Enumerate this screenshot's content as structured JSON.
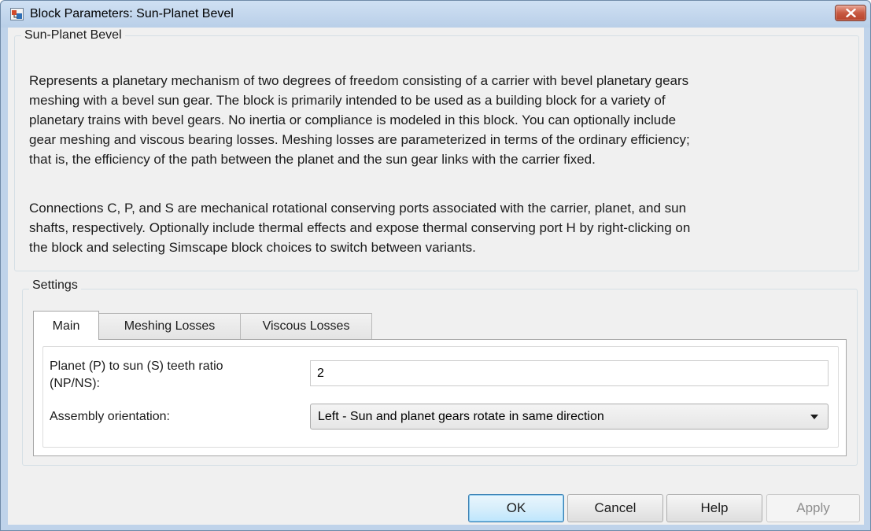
{
  "window": {
    "title": "Block Parameters: Sun-Planet Bevel"
  },
  "description_group": {
    "label": "Sun-Planet Bevel",
    "paragraph1_lines": [
      "Represents a planetary mechanism of two degrees of freedom consisting of a carrier with bevel planetary gears",
      "meshing with a bevel sun gear. The block is primarily intended to be used as a building block for a variety of",
      "planetary trains with bevel gears. No inertia or compliance is modeled in this block. You can optionally include",
      "gear meshing and viscous bearing losses. Meshing losses are parameterized in terms of the ordinary efficiency;",
      "that is, the efficiency of the path between the planet and the sun gear links with the carrier fixed."
    ],
    "paragraph2_lines": [
      "Connections C, P, and S are mechanical rotational conserving ports associated with the carrier, planet, and sun",
      "shafts, respectively. Optionally include thermal effects and expose thermal conserving port H by right-clicking on",
      "the block and selecting Simscape block choices to switch between variants."
    ]
  },
  "settings": {
    "label": "Settings",
    "tabs": [
      {
        "label": "Main",
        "active": true
      },
      {
        "label": "Meshing Losses",
        "active": false
      },
      {
        "label": "Viscous Losses",
        "active": false
      }
    ],
    "main": {
      "ratio_label_line1": "Planet (P) to sun (S) teeth ratio",
      "ratio_label_line2": "(NP/NS):",
      "ratio_value": "2",
      "orientation_label": "Assembly orientation:",
      "orientation_value": "Left - Sun and planet gears rotate in same direction"
    }
  },
  "buttons": {
    "ok": "OK",
    "cancel": "Cancel",
    "help": "Help",
    "apply": "Apply"
  },
  "colors": {
    "titlebar": "#bfd3ea",
    "close_button": "#c85a42",
    "client_background": "#f0f0f0",
    "default_button_border": "#3c7fb1"
  },
  "icons": {
    "window": "simulink-block-icon",
    "close": "close-icon",
    "dropdown": "chevron-down-icon"
  }
}
